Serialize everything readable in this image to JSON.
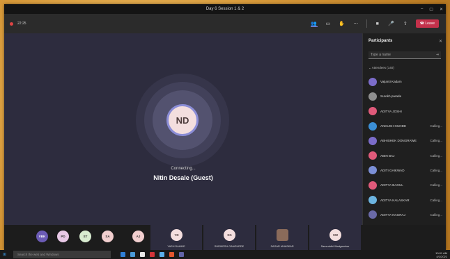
{
  "window": {
    "title": "Day 6 Session 1 & 2"
  },
  "toolbar": {
    "timer": "22:25",
    "leave_label": "Leave"
  },
  "stage": {
    "initials": "ND",
    "status": "Connecting...",
    "name": "Nitin Desale (Guest)"
  },
  "panel": {
    "title": "Participants",
    "search_placeholder": "Type a name",
    "attendees_header": "Attendees (140)",
    "participants": [
      {
        "name": "Vaijanti Kadam",
        "status": "",
        "color": "#7b6cc9"
      },
      {
        "name": "Surekh parade",
        "status": "",
        "color": "#8f8f8f"
      },
      {
        "name": "ADITYA JOSHI",
        "status": "",
        "color": "#e05a7a"
      },
      {
        "name": "ANKUSH GUNDE",
        "status": "Calling...",
        "color": "#3b8fd6"
      },
      {
        "name": "ABHISHEK DONGRAWE",
        "status": "Calling...",
        "color": "#7b6cc9"
      },
      {
        "name": "ABIN BAJ",
        "status": "Calling...",
        "color": "#e05a7a"
      },
      {
        "name": "ADITI GAIKWAD",
        "status": "Calling...",
        "color": "#7b8fd6"
      },
      {
        "name": "ADITYA BAGUL",
        "status": "Calling...",
        "color": "#e05a7a"
      },
      {
        "name": "ADITYA KALASKAR",
        "status": "Calling...",
        "color": "#6cb4e0"
      },
      {
        "name": "ADITYA NAGRAJ",
        "status": "Calling...",
        "color": "#6a6aa8"
      },
      {
        "name": "AISHWARYA DUTTAWE",
        "status": "Calling...",
        "color": "#e05a7a"
      }
    ]
  },
  "strip": {
    "chips": [
      {
        "initials": "VBK",
        "color": "#6b5bb5"
      },
      {
        "initials": "PD",
        "color": "#e8c8e6"
      },
      {
        "initials": "ST",
        "color": "#d8ecd0"
      },
      {
        "initials": "SA",
        "color": "#f2cfcf"
      },
      {
        "initials": "AJ",
        "color": "#f2cfcf"
      }
    ],
    "tiles": [
      {
        "initials": "YD",
        "label": "YASH DAHIKE"
      },
      {
        "initials": "SG",
        "label": "SHRIKESH GANGURDE"
      },
      {
        "initials": "",
        "label": "SAGAR MHASKAR"
      },
      {
        "initials": "SW",
        "label": "Samruddhi Wadgaonkar"
      }
    ]
  },
  "taskbar": {
    "search_placeholder": "Search the web and Windows",
    "clock_time": "10:01 AM",
    "clock_date": "4/1/2021"
  }
}
